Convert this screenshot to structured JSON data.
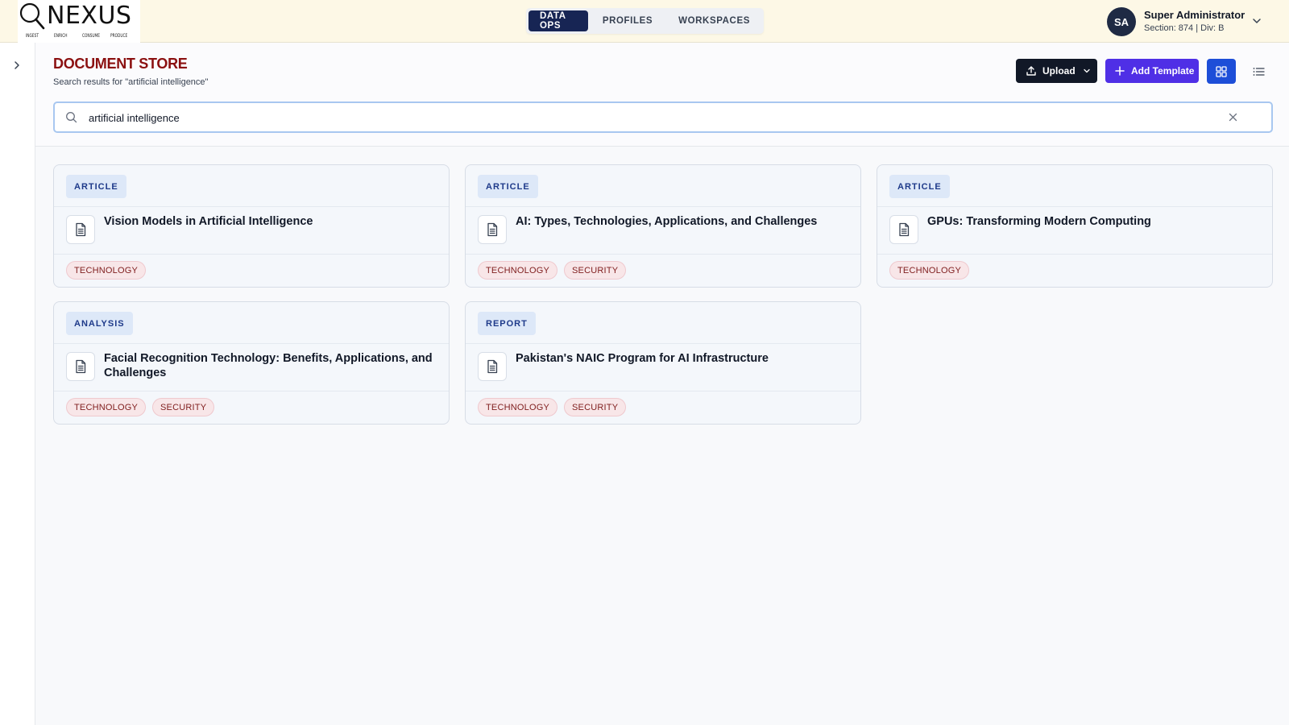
{
  "brand": {
    "name": "NEXUS",
    "tagline": [
      "INGEST",
      "ENRICH",
      "CONSUME",
      "PRODUCE"
    ]
  },
  "nav": {
    "tabs": [
      {
        "label": "DATA OPS",
        "active": true
      },
      {
        "label": "PROFILES",
        "active": false
      },
      {
        "label": "WORKSPACES",
        "active": false
      }
    ]
  },
  "user": {
    "initials": "SA",
    "name": "Super Administrator",
    "meta": "Section: 874 | Div: B"
  },
  "page": {
    "title": "DOCUMENT STORE",
    "subtitle": "Search results for \"artificial intelligence\""
  },
  "toolbar": {
    "upload_label": "Upload",
    "add_template_label": "Add Template"
  },
  "search": {
    "value": "artificial intelligence",
    "placeholder": ""
  },
  "cards": [
    {
      "type": "ARTICLE",
      "title": "Vision Models in Artificial Intelligence",
      "tags": [
        "TECHNOLOGY"
      ]
    },
    {
      "type": "ARTICLE",
      "title": "AI: Types, Technologies, Applications, and Challenges",
      "tags": [
        "TECHNOLOGY",
        "SECURITY"
      ]
    },
    {
      "type": "ARTICLE",
      "title": "GPUs: Transforming Modern Computing",
      "tags": [
        "TECHNOLOGY"
      ]
    },
    {
      "type": "ANALYSIS",
      "title": "Facial Recognition Technology: Benefits, Applications, and Challenges",
      "tags": [
        "TECHNOLOGY",
        "SECURITY"
      ]
    },
    {
      "type": "REPORT",
      "title": "Pakistan's NAIC Program for AI Infrastructure",
      "tags": [
        "TECHNOLOGY",
        "SECURITY"
      ]
    }
  ],
  "colors": {
    "title_red": "#8b1010",
    "nav_active": "#172554",
    "upload_btn": "#111827",
    "template_btn": "#4f2fe6",
    "grid_btn": "#1d4ed8",
    "type_badge_bg": "#dde8f8",
    "tag_bg": "#f8e6e8"
  },
  "icons": {
    "logo": "magnifier-icon",
    "user_menu": "chevron-down-icon",
    "sidebar_toggle": "chevron-right-icon",
    "upload": "upload-icon",
    "add_template": "plus-icon",
    "grid_view": "grid-icon",
    "list_view": "list-icon",
    "search": "search-icon",
    "clear": "close-icon",
    "document": "document-icon"
  }
}
